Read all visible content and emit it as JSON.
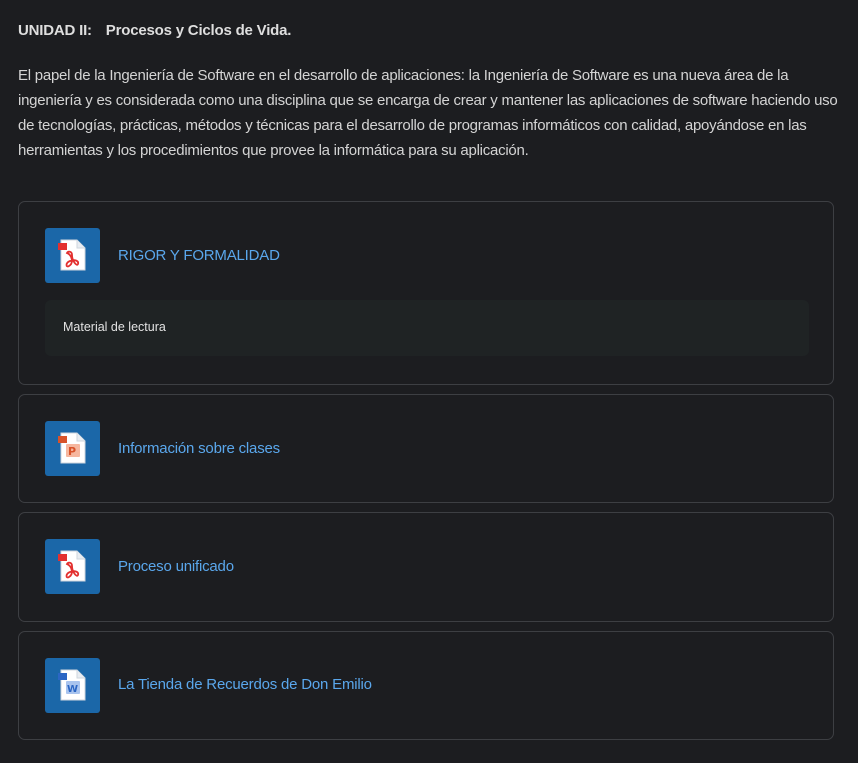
{
  "section": {
    "unit_label": "UNIDAD II:",
    "unit_title": "Procesos y Ciclos de Vida.",
    "intro": "El papel de la Ingeniería de Software en el desarrollo de aplicaciones: la Ingeniería de Software es una nueva área de la ingeniería y es considerada como una disciplina que se encarga de crear y mantener las aplicaciones de software haciendo uso de tecnologías, prácticas, métodos y técnicas para el desarrollo de programas informáticos con calidad, apoyándose en las herramientas y los procedimientos que provee la informática para su aplicación."
  },
  "activities": [
    {
      "name": "RIGOR Y FORMALIDAD",
      "icon": "pdf-file-icon",
      "description": "Material de lectura"
    },
    {
      "name": "Información sobre clases",
      "icon": "powerpoint-file-icon"
    },
    {
      "name": "Proceso unificado",
      "icon": "pdf-file-icon"
    },
    {
      "name": "La Tienda de Recuerdos de Don Emilio",
      "icon": "word-file-icon"
    }
  ],
  "colors": {
    "background": "#1c1d20",
    "link": "#5aa7ec",
    "icon_bg": "#1b67a8",
    "border": "#3d3f43",
    "pdf": "#e3302f",
    "powerpoint": "#d8532a",
    "word": "#2b66c4"
  }
}
